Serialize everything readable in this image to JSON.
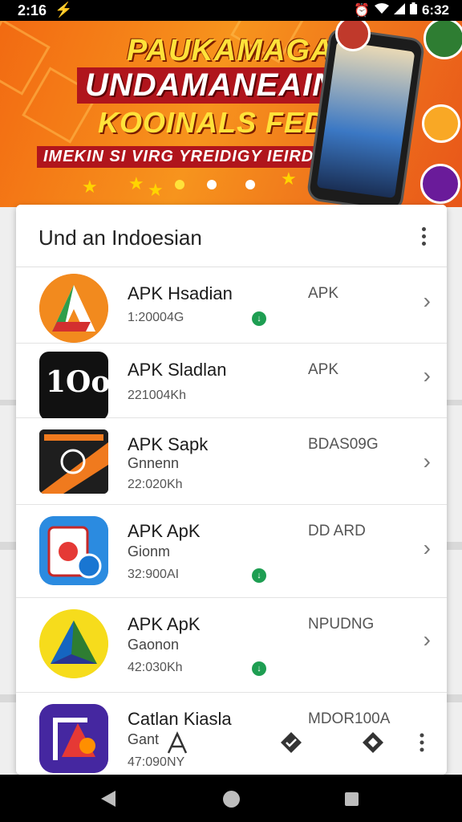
{
  "status_bar": {
    "time": "2:16",
    "right_text": "6:32",
    "icons": [
      "charging-bolt-icon",
      "alarm-icon",
      "wifi-icon",
      "signal-icon",
      "battery-icon"
    ]
  },
  "banner": {
    "line1": "PAUKAMAGAN",
    "line2": "UNDAMANEAIN",
    "line3": "KOOINALS FEDUI4",
    "line4": "IMEKIN SI VIRG YREIDIGY IEIRDIN",
    "active_slide": 1,
    "slides": 3
  },
  "panel": {
    "title": "Und an Indoesian",
    "apps": [
      {
        "name": "APK Hsadian",
        "sub": "",
        "size": "1:20004G",
        "tag": "APK",
        "download": true,
        "icon": "orange-a-app-icon"
      },
      {
        "name": "APK Sladlan",
        "sub": "",
        "size": "221004Kh",
        "tag": "APK",
        "download": false,
        "icon": "black-rounded-logo-app-icon"
      },
      {
        "name": "APK Sapk",
        "sub": "Gnnenn",
        "size": "22:020Kh",
        "tag": "BDAS09G",
        "download": false,
        "icon": "game-poster-app-icon"
      },
      {
        "name": "APK ApK",
        "sub": "Gionm",
        "size": "32:900AI",
        "tag": "DD ARD",
        "download": true,
        "icon": "tablet-app-icon"
      },
      {
        "name": "APK ApK",
        "sub": "Gaonon",
        "size": "42:030Kh",
        "tag": "NPUDNG",
        "download": true,
        "icon": "triangle-app-icon"
      },
      {
        "name": "Catlan Kiasla",
        "sub": "Gant",
        "size": "47:090NY",
        "tag": "MDOR100A",
        "download": false,
        "icon": "purple-a-app-icon"
      }
    ]
  },
  "colors": {
    "banner_orange": "#f26a12",
    "banner_yellow": "#ffe23a",
    "banner_red": "#b0151c",
    "download_green": "#1e9e52"
  }
}
